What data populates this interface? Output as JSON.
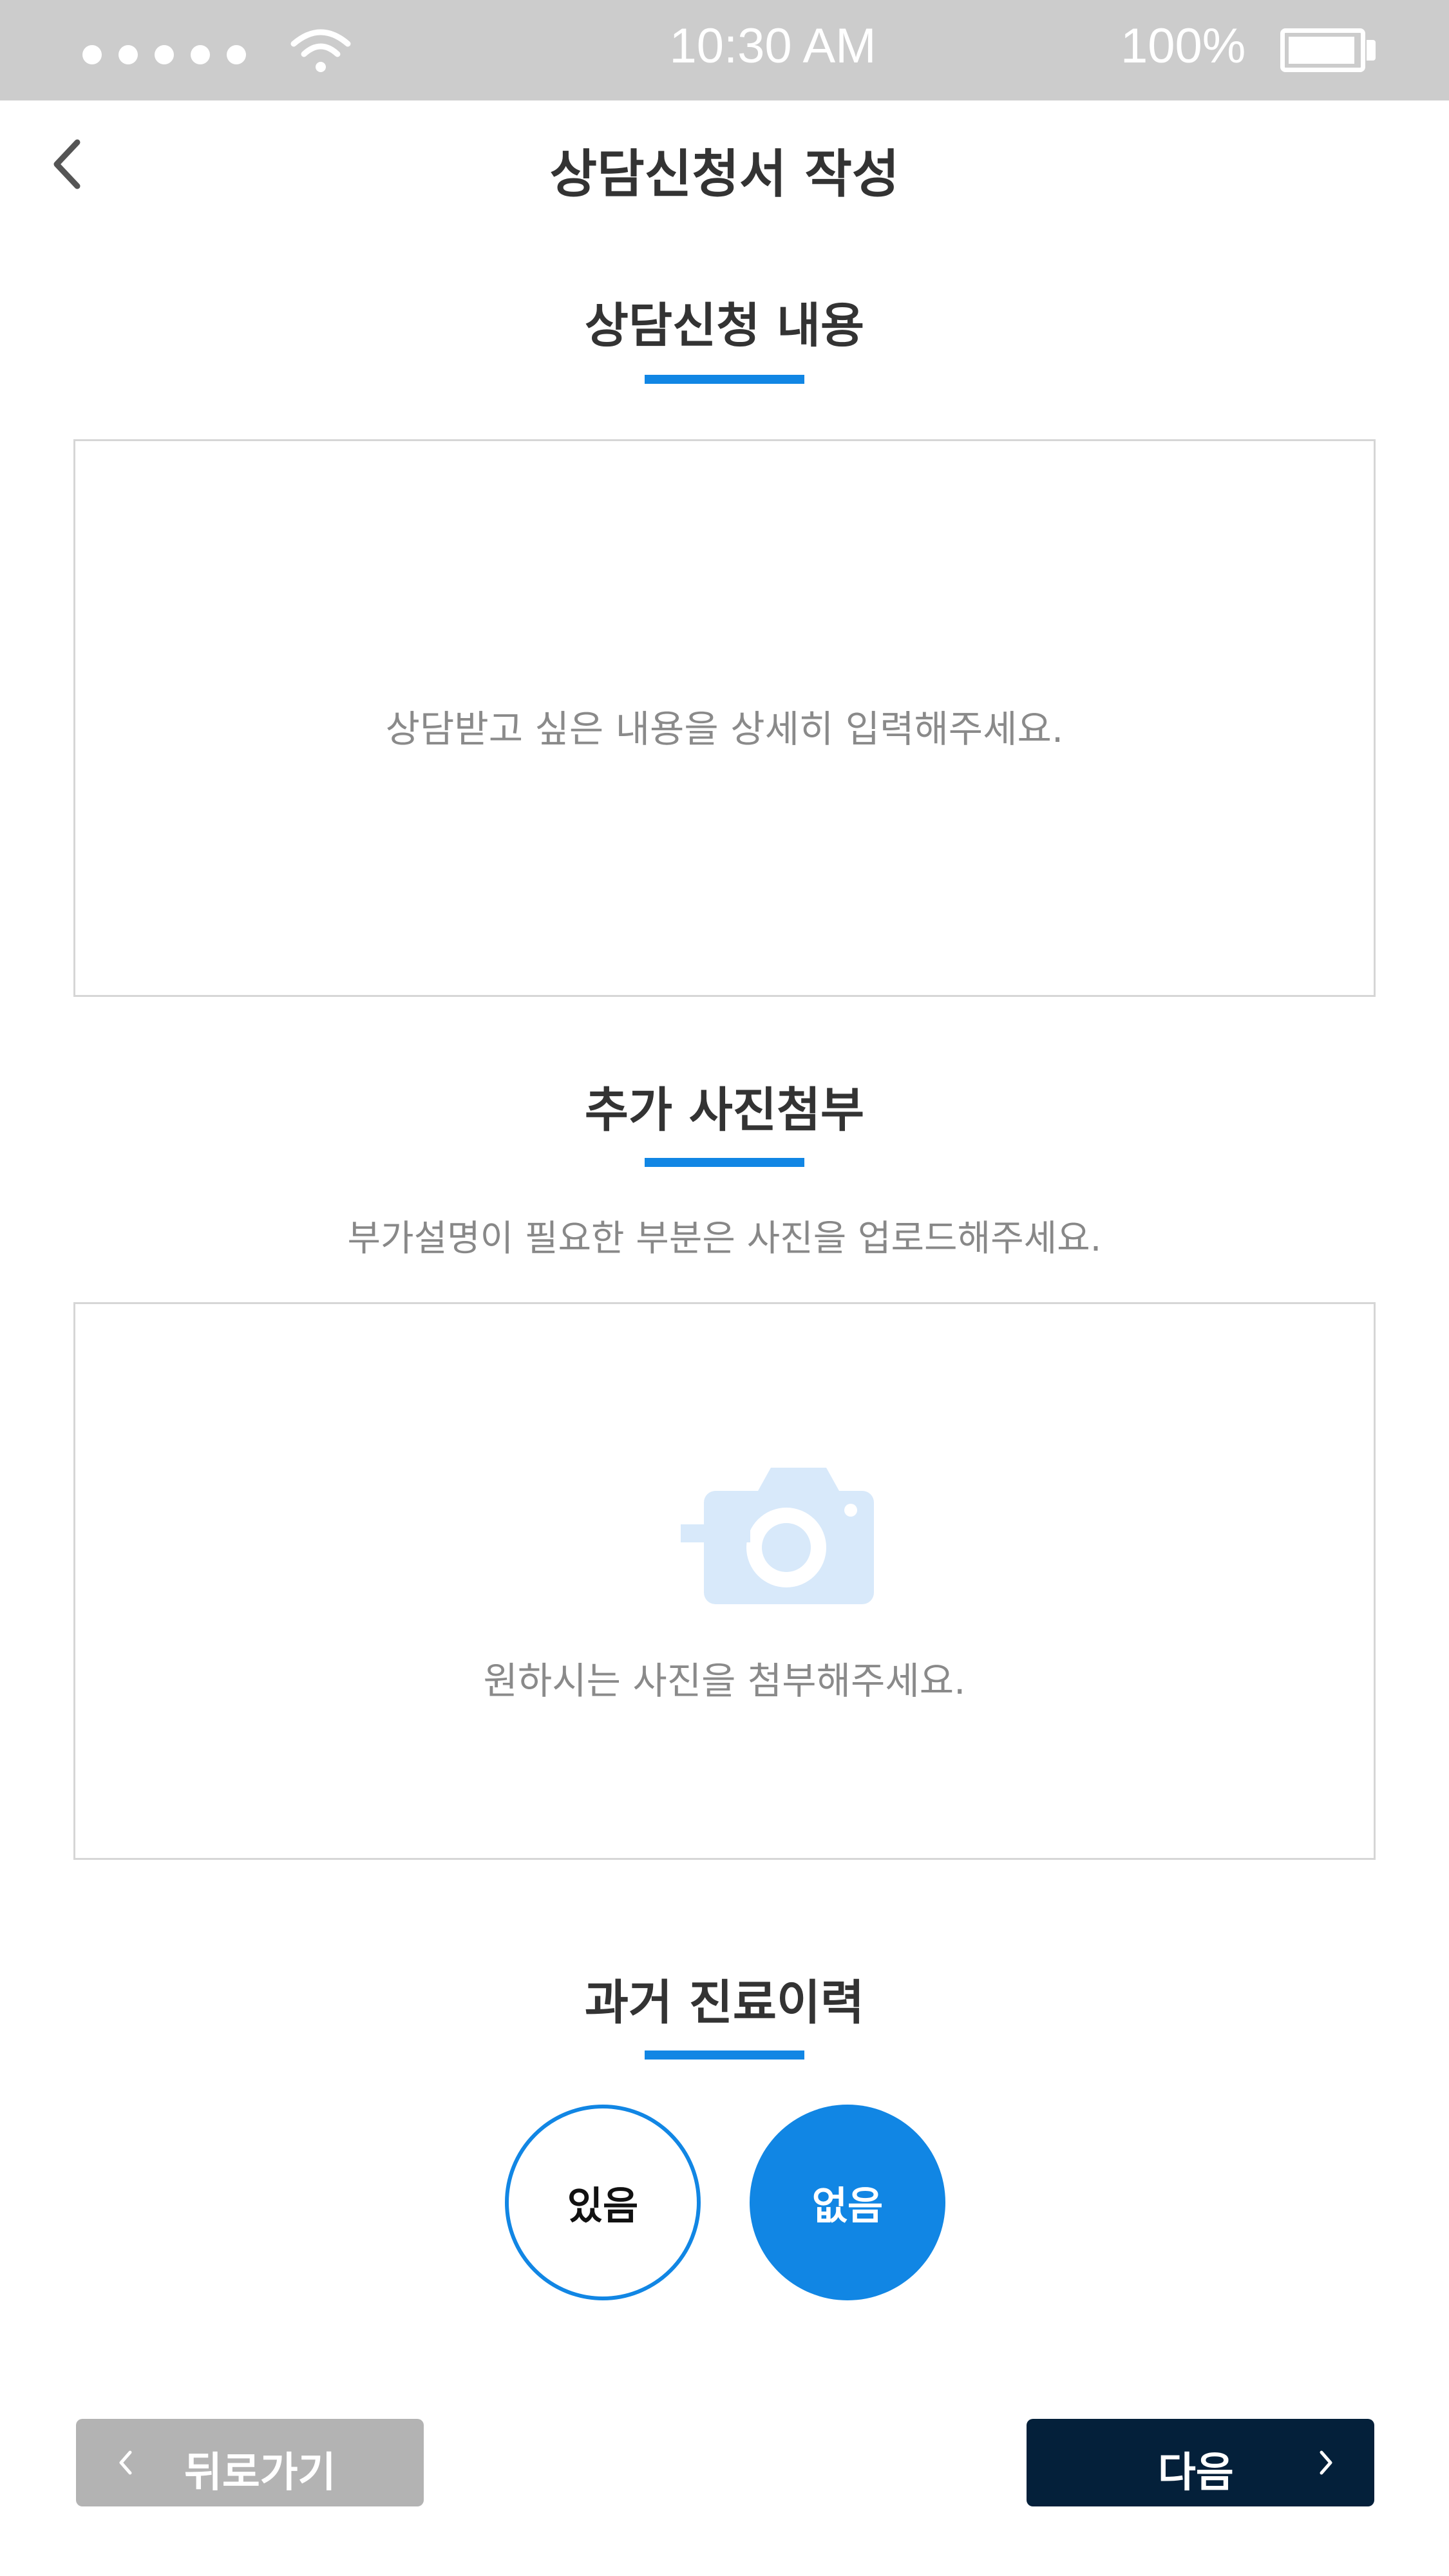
{
  "status_bar": {
    "time": "10:30 AM",
    "battery_percent": "100%",
    "signal_icon": "signal-dots-icon",
    "wifi_icon": "wifi-icon",
    "battery_icon": "battery-icon"
  },
  "header": {
    "back_icon": "chevron-left-icon",
    "title": "상담신청서 작성"
  },
  "section_content": {
    "title": "상담신청 내용",
    "placeholder": "상담받고 싶은 내용을 상세히 입력해주세요."
  },
  "section_photo": {
    "title": "추가 사진첨부",
    "description": "부가설명이 필요한 부분은 사진을 업로드해주세요.",
    "upload_icon": "camera-add-icon",
    "upload_text": "원하시는 사진을 첨부해주세요."
  },
  "section_history": {
    "title": "과거 진료이력",
    "options": [
      {
        "label": "있음",
        "selected": false
      },
      {
        "label": "없음",
        "selected": true
      }
    ]
  },
  "footer": {
    "back_label": "뒤로가기",
    "next_label": "다음"
  },
  "colors": {
    "accent": "#1186e4",
    "status_bar": "#cccccc",
    "next_button": "#04203a",
    "back_button": "#b3b3b3"
  }
}
